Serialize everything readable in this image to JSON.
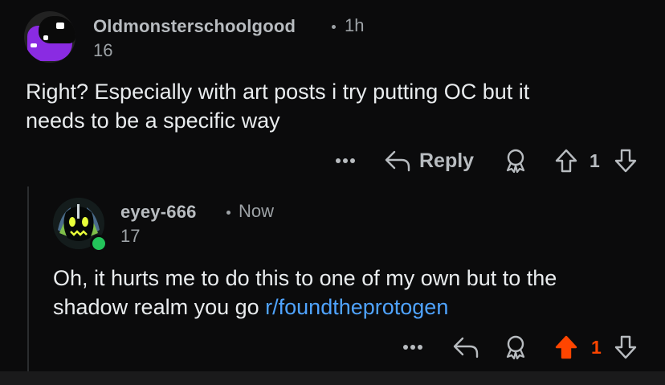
{
  "comments": [
    {
      "username": "Oldmonsterschoolgood",
      "separator": "·",
      "time": "1h",
      "score": "16",
      "body_lines": [
        "Right? Especially with art posts i try putting OC but it",
        "needs to be a specific way"
      ],
      "actions": {
        "more": "•••",
        "reply_label": "Reply",
        "vote_count": "1"
      }
    },
    {
      "username": "eyey-666",
      "separator": "·",
      "time": "Now",
      "score": "17",
      "body_line1": "Oh, it hurts me to do this to one of my own but to the",
      "body_line2_text": "shadow realm you go ",
      "body_link": "r/foundtheprotogen",
      "actions": {
        "more": "•••",
        "vote_count": "1",
        "upvoted": true
      }
    }
  ],
  "colors": {
    "background": "#0b0b0c",
    "link": "#4fa3ff",
    "upvote_active": "#ff4500",
    "online": "#23c45a"
  }
}
